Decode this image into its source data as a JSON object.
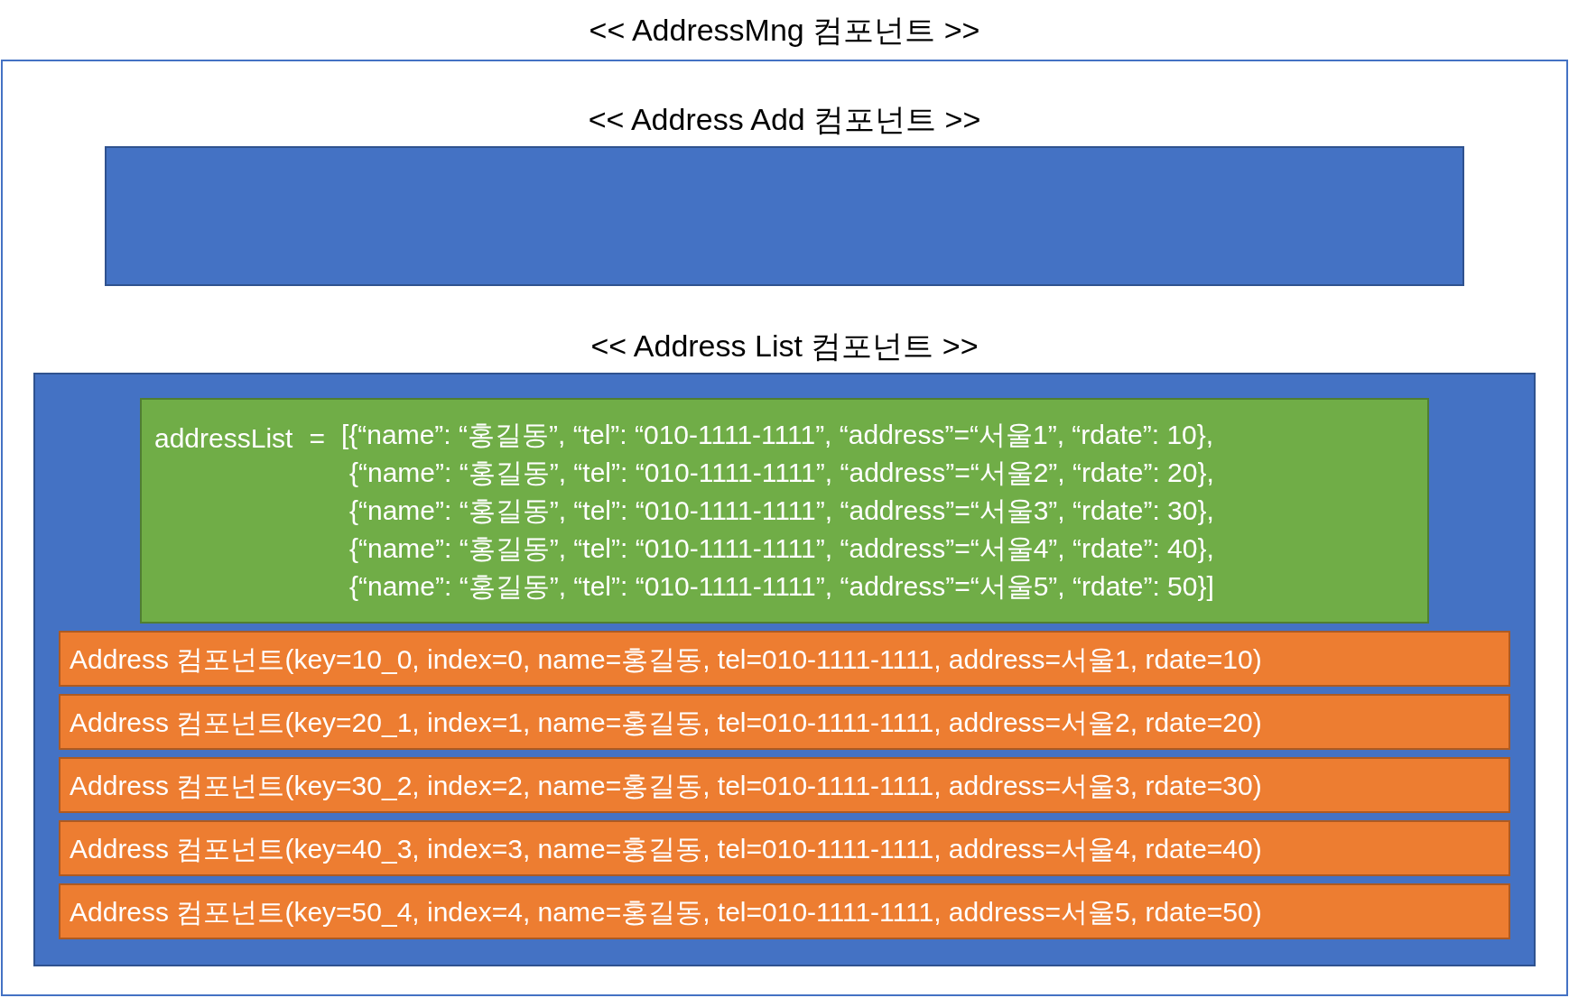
{
  "title": "<< AddressMng 컴포넌트 >>",
  "add_component": {
    "title": "<< Address Add 컴포넌트 >>"
  },
  "list_component": {
    "title": "<< Address List 컴포넌트 >>",
    "state": {
      "variable": "addressList",
      "operator": "=",
      "lines": [
        "[{“name”: “홍길동”, “tel”: “010-1111-1111”, “address”=“서울1”, “rdate”: 10},",
        "{“name”: “홍길동”, “tel”: “010-1111-1111”, “address”=“서울2”, “rdate”: 20},",
        "{“name”: “홍길동”, “tel”: “010-1111-1111”, “address”=“서울3”, “rdate”: 30},",
        "{“name”: “홍길동”, “tel”: “010-1111-1111”, “address”=“서울4”, “rdate”: 40},",
        "{“name”: “홍길동”, “tel”: “010-1111-1111”, “address”=“서울5”, “rdate”: 50}]"
      ]
    },
    "items": [
      "Address 컴포넌트(key=10_0, index=0, name=홍길동, tel=010-1111-1111, address=서울1, rdate=10)",
      "Address 컴포넌트(key=20_1, index=1, name=홍길동, tel=010-1111-1111, address=서울2, rdate=20)",
      "Address 컴포넌트(key=30_2, index=2, name=홍길동, tel=010-1111-1111, address=서울3, rdate=30)",
      "Address 컴포넌트(key=40_3, index=3, name=홍길동, tel=010-1111-1111, address=서울4, rdate=40)",
      "Address 컴포넌트(key=50_4, index=4, name=홍길동, tel=010-1111-1111, address=서울5, rdate=50)"
    ]
  }
}
